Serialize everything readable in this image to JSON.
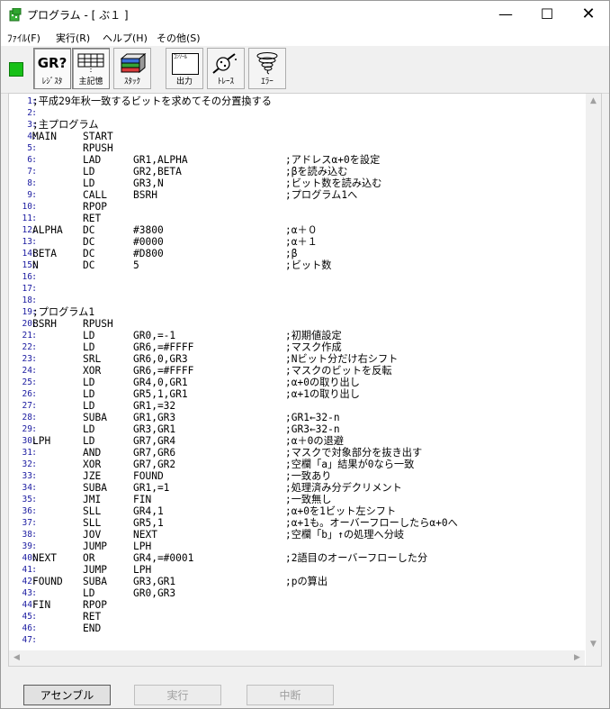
{
  "window": {
    "title": "プログラム - [ ぶ１ ]",
    "minimize_glyph": "—",
    "maximize_glyph": "☐",
    "close_glyph": "✕"
  },
  "menu": [
    "ﾌｧｲﾙ(F)",
    "実行(R)",
    "ヘルプ(H)",
    "その他(S)"
  ],
  "toolbar": {
    "status_color": "#18c018",
    "buttons": [
      {
        "label": "ﾚｼﾞｽﾀ",
        "icon": "gr-register-icon",
        "icon_text": "GR?",
        "pressed": true
      },
      {
        "label": "主記憶",
        "icon": "memory-grid-icon",
        "pressed": true
      },
      {
        "label": "ｽﾀｯｸ",
        "icon": "stack-icon",
        "pressed": false
      },
      {
        "label": "出力",
        "icon": "console-output-icon",
        "icon_text": "ｺﾝｿｰﾙ",
        "pressed": false
      },
      {
        "label": "ﾄﾚｰｽ",
        "icon": "trace-magnifier-icon",
        "pressed": false
      },
      {
        "label": "ｴﾗｰ",
        "icon": "error-tornado-icon",
        "pressed": false
      }
    ]
  },
  "code_lines": [
    {
      "n": "1",
      "label": ";平成29年秋一致するビットを求めてその分置換する",
      "op": "",
      "arg": "",
      "cmt": ""
    },
    {
      "n": "2",
      "label": "",
      "op": "",
      "arg": "",
      "cmt": ""
    },
    {
      "n": "3",
      "label": ";主プログラム",
      "op": "",
      "arg": "",
      "cmt": ""
    },
    {
      "n": "4",
      "label": "MAIN",
      "op": "START",
      "arg": "",
      "cmt": ""
    },
    {
      "n": "5",
      "label": "",
      "op": "RPUSH",
      "arg": "",
      "cmt": ""
    },
    {
      "n": "6",
      "label": "",
      "op": "LAD",
      "arg": "GR1,ALPHA",
      "cmt": ";アドレスα+0を設定"
    },
    {
      "n": "7",
      "label": "",
      "op": "LD",
      "arg": "GR2,BETA",
      "cmt": ";βを読み込む"
    },
    {
      "n": "8",
      "label": "",
      "op": "LD",
      "arg": "GR3,N",
      "cmt": ";ビット数を読み込む"
    },
    {
      "n": "9",
      "label": "",
      "op": "CALL",
      "arg": "BSRH",
      "cmt": ";プログラム1へ"
    },
    {
      "n": "10",
      "label": "",
      "op": "RPOP",
      "arg": "",
      "cmt": ""
    },
    {
      "n": "11",
      "label": "",
      "op": "RET",
      "arg": "",
      "cmt": ""
    },
    {
      "n": "12",
      "label": "ALPHA",
      "op": "DC",
      "arg": "#3800",
      "cmt": ";α＋０"
    },
    {
      "n": "13",
      "label": "",
      "op": "DC",
      "arg": "#0000",
      "cmt": ";α＋１"
    },
    {
      "n": "14",
      "label": "BETA",
      "op": "DC",
      "arg": "#D800",
      "cmt": ";β"
    },
    {
      "n": "15",
      "label": "N",
      "op": "DC",
      "arg": "5",
      "cmt": ";ビット数"
    },
    {
      "n": "16",
      "label": "",
      "op": "",
      "arg": "",
      "cmt": ""
    },
    {
      "n": "17",
      "label": "",
      "op": "",
      "arg": "",
      "cmt": ""
    },
    {
      "n": "18",
      "label": "",
      "op": "",
      "arg": "",
      "cmt": ""
    },
    {
      "n": "19",
      "label": ";プログラム1",
      "op": "",
      "arg": "",
      "cmt": ""
    },
    {
      "n": "20",
      "label": "BSRH",
      "op": "RPUSH",
      "arg": "",
      "cmt": ""
    },
    {
      "n": "21",
      "label": "",
      "op": "LD",
      "arg": "GR0,=-1",
      "cmt": ";初期値設定"
    },
    {
      "n": "22",
      "label": "",
      "op": "LD",
      "arg": "GR6,=#FFFF",
      "cmt": ";マスク作成"
    },
    {
      "n": "23",
      "label": "",
      "op": "SRL",
      "arg": "GR6,0,GR3",
      "cmt": ";Nビット分だけ右シフト"
    },
    {
      "n": "24",
      "label": "",
      "op": "XOR",
      "arg": "GR6,=#FFFF",
      "cmt": ";マスクのビットを反転"
    },
    {
      "n": "25",
      "label": "",
      "op": "LD",
      "arg": "GR4,0,GR1",
      "cmt": ";α+0の取り出し"
    },
    {
      "n": "26",
      "label": "",
      "op": "LD",
      "arg": "GR5,1,GR1",
      "cmt": ";α+1の取り出し"
    },
    {
      "n": "27",
      "label": "",
      "op": "LD",
      "arg": "GR1,=32",
      "cmt": ""
    },
    {
      "n": "28",
      "label": "",
      "op": "SUBA",
      "arg": "GR1,GR3",
      "cmt": ";GR1←32-n"
    },
    {
      "n": "29",
      "label": "",
      "op": "LD",
      "arg": "GR3,GR1",
      "cmt": ";GR3←32-n"
    },
    {
      "n": "30",
      "label": "LPH",
      "op": "LD",
      "arg": "GR7,GR4",
      "cmt": ";α＋0の退避"
    },
    {
      "n": "31",
      "label": "",
      "op": "AND",
      "arg": "GR7,GR6",
      "cmt": ";マスクで対象部分を抜き出す"
    },
    {
      "n": "32",
      "label": "",
      "op": "XOR",
      "arg": "GR7,GR2",
      "cmt": ";空欄「a」結果が0なら一致"
    },
    {
      "n": "33",
      "label": "",
      "op": "JZE",
      "arg": "FOUND",
      "cmt": ";一致あり"
    },
    {
      "n": "34",
      "label": "",
      "op": "SUBA",
      "arg": "GR1,=1",
      "cmt": ";処理済み分デクリメント"
    },
    {
      "n": "35",
      "label": "",
      "op": "JMI",
      "arg": "FIN",
      "cmt": ";一致無し"
    },
    {
      "n": "36",
      "label": "",
      "op": "SLL",
      "arg": "GR4,1",
      "cmt": ";α+0を1ビット左シフト"
    },
    {
      "n": "37",
      "label": "",
      "op": "SLL",
      "arg": "GR5,1",
      "cmt": ";α+1も。オーバーフローしたらα+0へ"
    },
    {
      "n": "38",
      "label": "",
      "op": "JOV",
      "arg": "NEXT",
      "cmt": ";空欄「b」↑の処理へ分岐"
    },
    {
      "n": "39",
      "label": "",
      "op": "JUMP",
      "arg": "LPH",
      "cmt": ""
    },
    {
      "n": "40",
      "label": "NEXT",
      "op": "OR",
      "arg": "GR4,=#0001",
      "cmt": ";2語目のオーバーフローした分"
    },
    {
      "n": "41",
      "label": "",
      "op": "JUMP",
      "arg": "LPH",
      "cmt": ""
    },
    {
      "n": "42",
      "label": "FOUND",
      "op": "SUBA",
      "arg": "GR3,GR1",
      "cmt": ";pの算出"
    },
    {
      "n": "43",
      "label": "",
      "op": "LD",
      "arg": "GR0,GR3",
      "cmt": ""
    },
    {
      "n": "44",
      "label": "FIN",
      "op": "RPOP",
      "arg": "",
      "cmt": ""
    },
    {
      "n": "45",
      "label": "",
      "op": "RET",
      "arg": "",
      "cmt": ""
    },
    {
      "n": "46",
      "label": "",
      "op": "END",
      "arg": "",
      "cmt": ""
    },
    {
      "n": "47",
      "label": "",
      "op": "",
      "arg": "",
      "cmt": ""
    }
  ],
  "buttons": {
    "assemble": "アセンブル",
    "run": "実行",
    "abort": "中断"
  }
}
